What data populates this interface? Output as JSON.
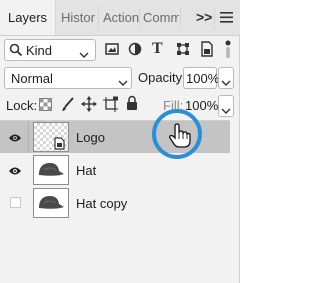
{
  "tabs": {
    "items": [
      {
        "label": "Layers"
      },
      {
        "label": "Histor"
      },
      {
        "label": "Action"
      },
      {
        "label": "Comm"
      }
    ],
    "more": ">>",
    "menu_icon": "hamburger-icon"
  },
  "filter": {
    "label": "Kind",
    "icons": [
      "image-filter-icon",
      "adjustment-filter-icon",
      "type-filter-icon",
      "shape-filter-icon",
      "smart-object-filter-icon",
      "filter-toggle-icon"
    ]
  },
  "blend": {
    "mode": "Normal",
    "opacity_label": "Opacity:",
    "opacity_value": "100%"
  },
  "lock": {
    "label": "Lock:",
    "icons": [
      "lock-transparent-icon",
      "lock-image-icon",
      "lock-position-icon",
      "lock-artboard-icon",
      "lock-all-icon"
    ],
    "fill_label": "Fill:",
    "fill_value": "100%"
  },
  "layers": [
    {
      "name": "Logo",
      "visible": true,
      "selected": true,
      "thumb": "smart-object"
    },
    {
      "name": "Hat",
      "visible": true,
      "selected": false,
      "thumb": "hat"
    },
    {
      "name": "Hat copy",
      "visible": false,
      "selected": false,
      "thumb": "hat"
    }
  ],
  "colors": {
    "selected_row": "#c4c4c4",
    "cursor_ring": "#2b8fd8"
  }
}
